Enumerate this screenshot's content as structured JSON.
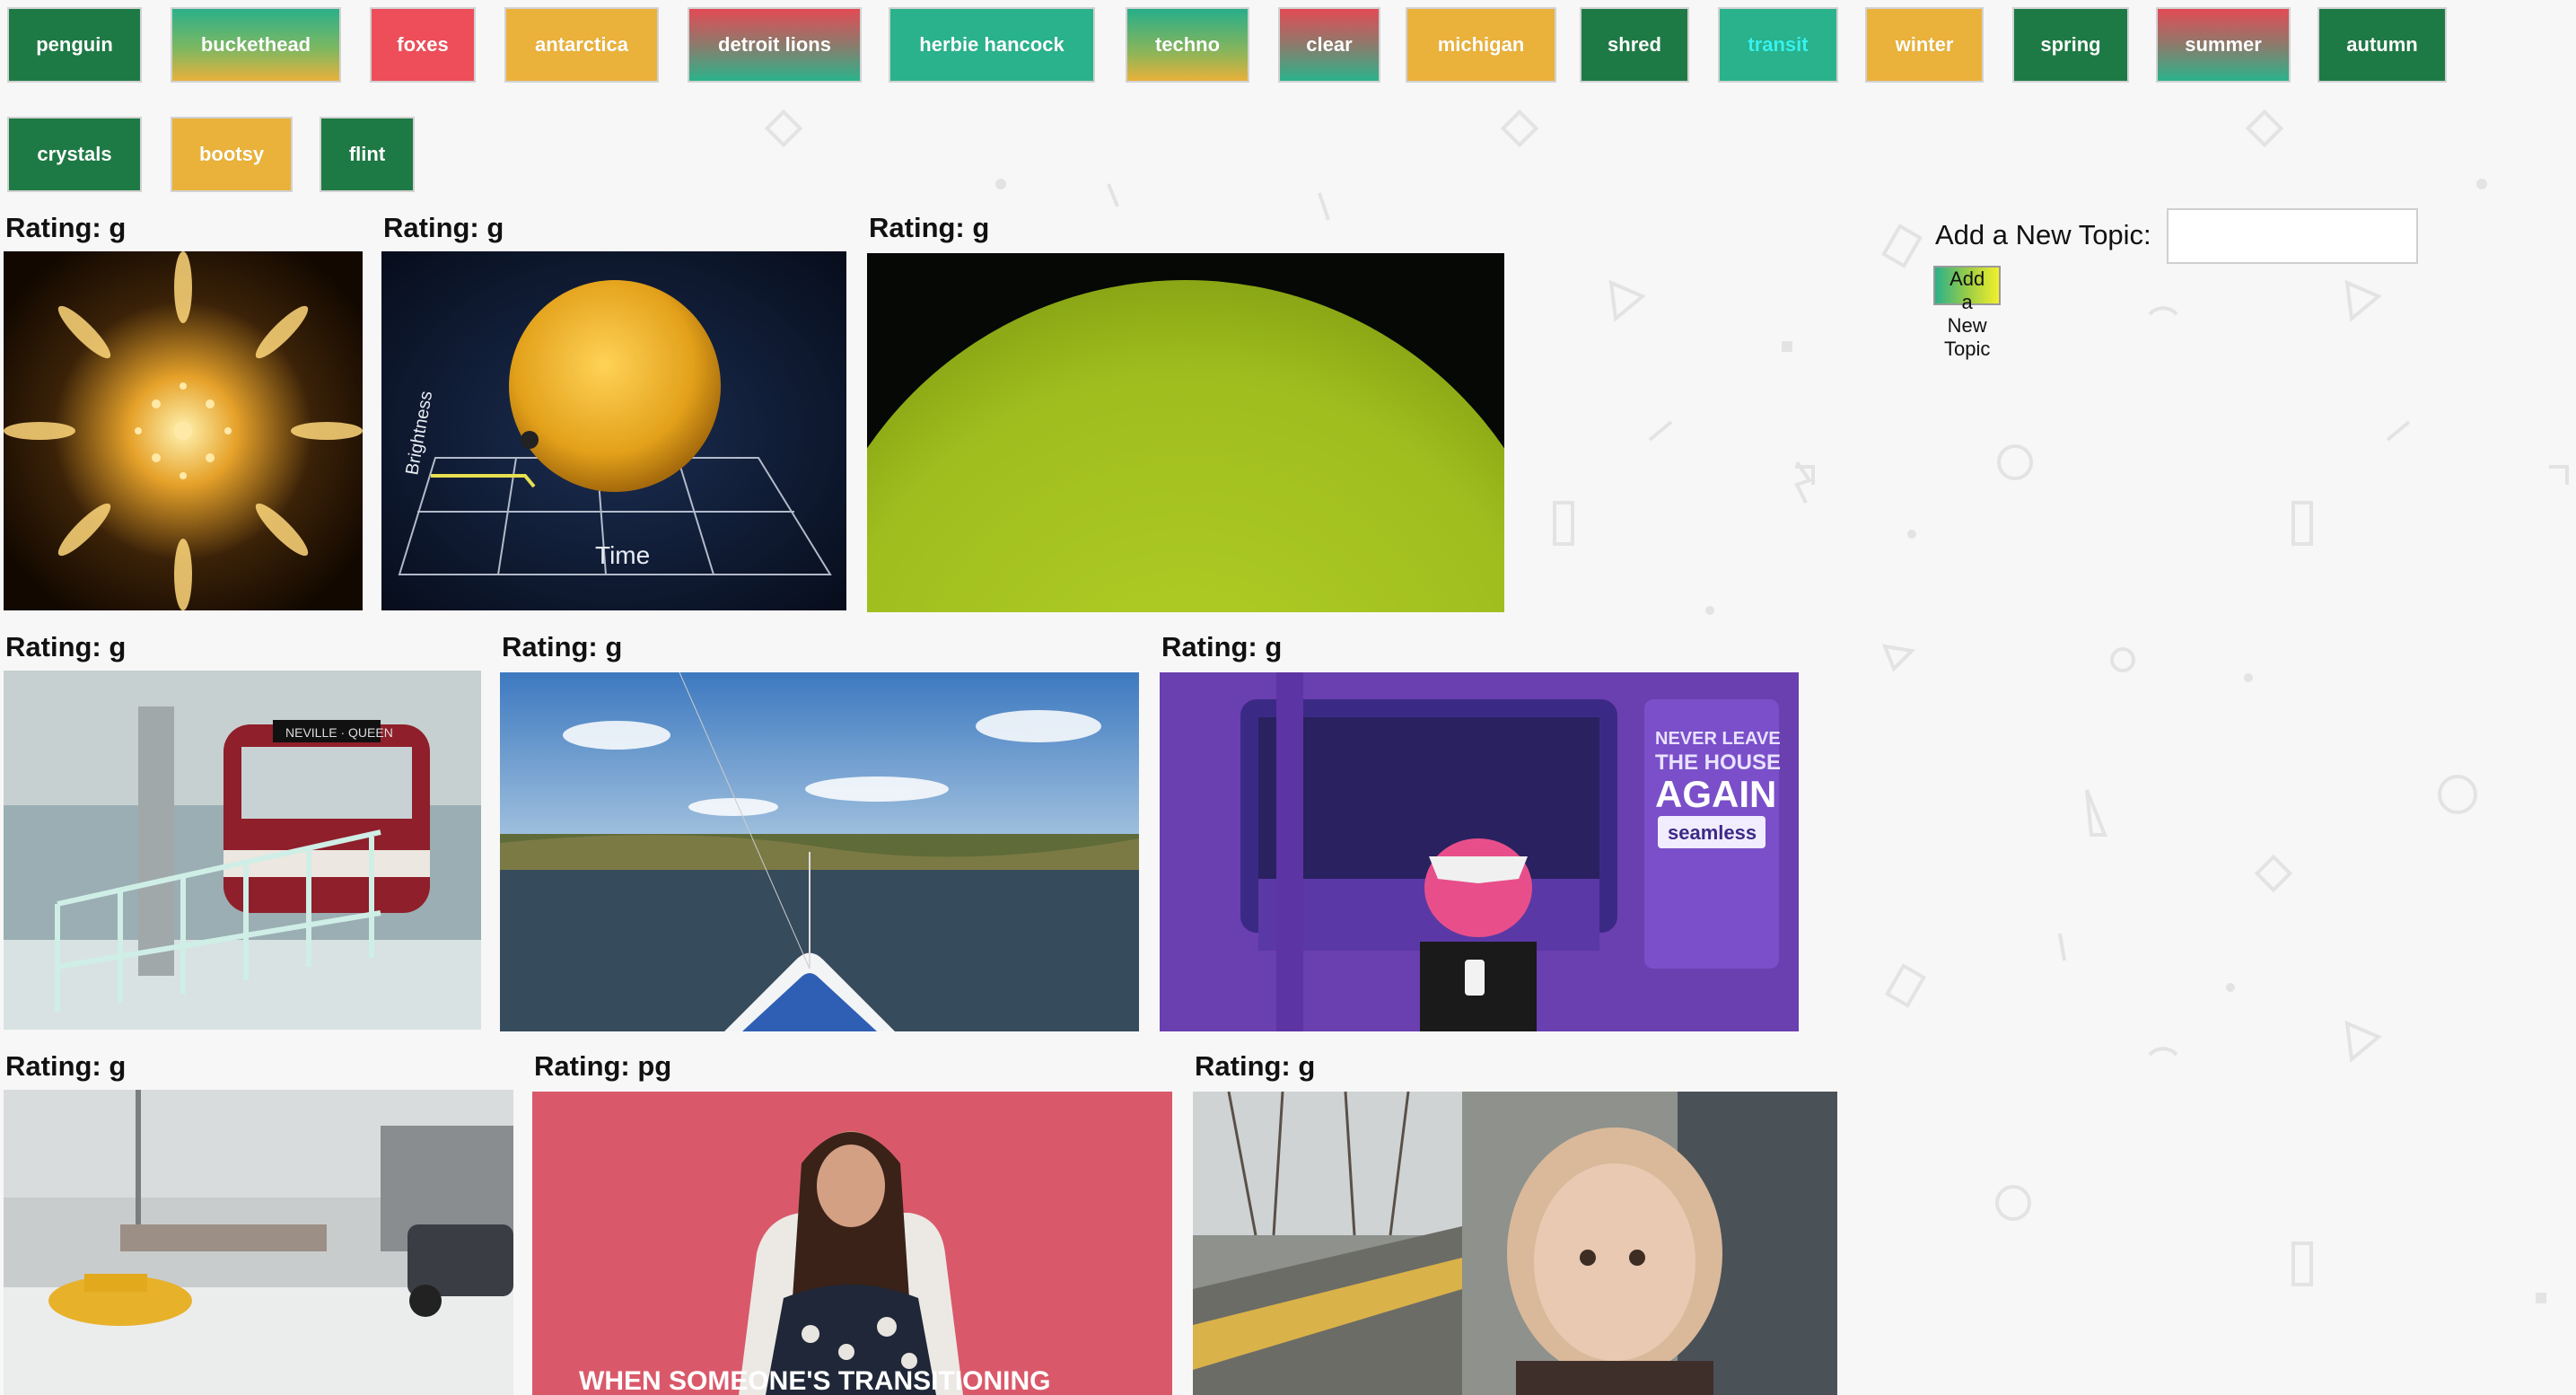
{
  "topics": [
    {
      "label": "penguin",
      "style": "b-green"
    },
    {
      "label": "buckethead",
      "style": "b-tg-y"
    },
    {
      "label": "foxes",
      "style": "b-red"
    },
    {
      "label": "antarctica",
      "style": "b-yellow"
    },
    {
      "label": "detroit lions",
      "style": "b-r-tg"
    },
    {
      "label": "herbie hancock",
      "style": "b-teal"
    },
    {
      "label": "techno",
      "style": "b-tg-y2"
    },
    {
      "label": "clear",
      "style": "b-r-tg"
    },
    {
      "label": "michigan",
      "style": "b-yellow"
    },
    {
      "label": "shred",
      "style": "b-green"
    },
    {
      "label": "transit",
      "style": "b-transit"
    },
    {
      "label": "winter",
      "style": "b-yellow"
    },
    {
      "label": "spring",
      "style": "b-green"
    },
    {
      "label": "summer",
      "style": "b-r-tg"
    },
    {
      "label": "autumn",
      "style": "b-green"
    },
    {
      "label": "crystals",
      "style": "b-green"
    },
    {
      "label": "bootsy",
      "style": "b-yellow"
    },
    {
      "label": "flint",
      "style": "b-green"
    }
  ],
  "add_topic": {
    "label": "Add a New Topic:",
    "input_value": "",
    "button_label": "Add a New Topic"
  },
  "gifs": [
    {
      "rating": "Rating: g",
      "name": "starburst-kaleidoscope-gif"
    },
    {
      "rating": "Rating: g",
      "name": "sun-brightness-time-gif",
      "text": {
        "axis_y": "Brightness",
        "axis_x": "Time"
      }
    },
    {
      "rating": "Rating: g",
      "name": "green-sun-gif"
    },
    {
      "rating": "Rating: g",
      "name": "streetcar-snow-gif",
      "text": {
        "sign": "NEVILLE · QUEEN"
      }
    },
    {
      "rating": "Rating: g",
      "name": "ship-bow-river-gif"
    },
    {
      "rating": "Rating: g",
      "name": "seamless-subway-dino-gif",
      "text": {
        "line1": "NEVER LEAVE",
        "line2": "THE HOUSE",
        "line3": "AGAIN",
        "brand": "seamless"
      }
    },
    {
      "rating": "Rating: g",
      "name": "snowstorm-taxi-gif"
    },
    {
      "rating": "Rating: pg",
      "name": "woman-chair-caption-gif",
      "text": {
        "caption": "WHEN SOMEONE'S TRANSITIONING"
      }
    },
    {
      "rating": "Rating: g",
      "name": "girl-train-platform-gif"
    }
  ]
}
